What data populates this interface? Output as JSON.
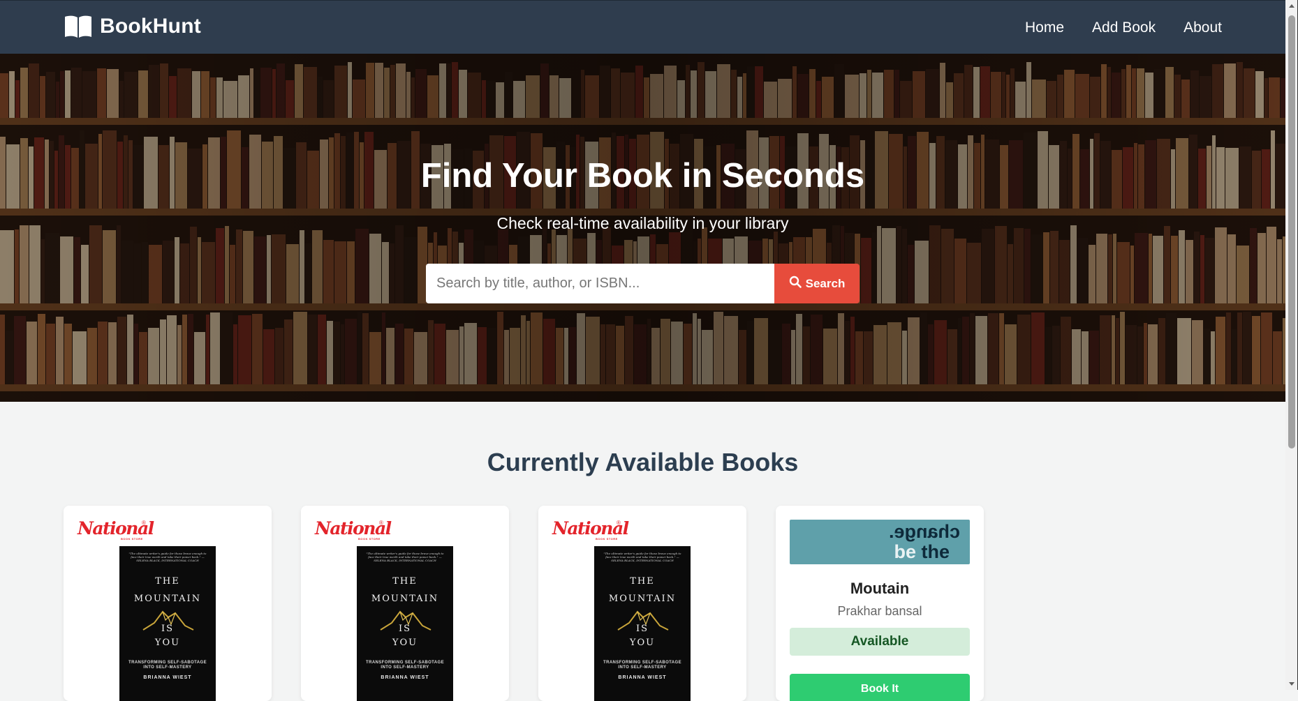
{
  "nav": {
    "brand": "BookHunt",
    "links": [
      "Home",
      "Add Book",
      "About"
    ]
  },
  "hero": {
    "title": "Find Your Book in Seconds",
    "subtitle": "Check real-time availability in your library",
    "search_placeholder": "Search by title, author, or ISBN...",
    "search_button": "Search"
  },
  "section": {
    "title": "Currently Available Books"
  },
  "books": [
    {
      "store_logo": "National",
      "store_logo_sub": "BOOK STORE",
      "cover_quote": "\"The ultimate writer's guide for those brave enough to face their true worth and take their power back.\" — SELENA BLACK, INTERNATIONAL COACH",
      "cover_title": [
        "THE",
        "MOUNTAIN",
        "IS",
        "YOU"
      ],
      "cover_subtitle": [
        "TRANSFORMING SELF-SABOTAGE",
        "INTO SELF-MASTERY"
      ],
      "cover_author": "BRIANNA WIEST"
    },
    {
      "store_logo": "National",
      "store_logo_sub": "BOOK STORE",
      "cover_quote": "\"The ultimate writer's guide for those brave enough to face their true worth and take their power back.\" — SELENA BLACK, INTERNATIONAL COACH",
      "cover_title": [
        "THE",
        "MOUNTAIN",
        "IS",
        "YOU"
      ],
      "cover_subtitle": [
        "TRANSFORMING SELF-SABOTAGE",
        "INTO SELF-MASTERY"
      ],
      "cover_author": "BRIANNA WIEST"
    },
    {
      "store_logo": "National",
      "store_logo_sub": "BOOK STORE",
      "cover_quote": "\"The ultimate writer's guide for those brave enough to face their true worth and take their power back.\" — SELENA BLACK, INTERNATIONAL COACH",
      "cover_title": [
        "THE",
        "MOUNTAIN",
        "IS",
        "YOU"
      ],
      "cover_subtitle": [
        "TRANSFORMING SELF-SABOTAGE",
        "INTO SELF-MASTERY"
      ],
      "cover_author": "BRIANNA WIEST"
    },
    {
      "cover_text_mirrored": "change.",
      "cover_text_a": "be",
      "cover_text_b": "the",
      "title": "Moutain",
      "author": "Prakhar bansal",
      "status": "Available",
      "button": "Book It"
    }
  ],
  "colors": {
    "navbar": "#2f3d4e",
    "search_button": "#e74c3c",
    "heading": "#2c3e50",
    "available_bg": "#d4edda",
    "available_text": "#155724",
    "book_button": "#2ecc71"
  },
  "icons": {
    "brand": "open-book-icon",
    "search": "magnifier-icon"
  }
}
